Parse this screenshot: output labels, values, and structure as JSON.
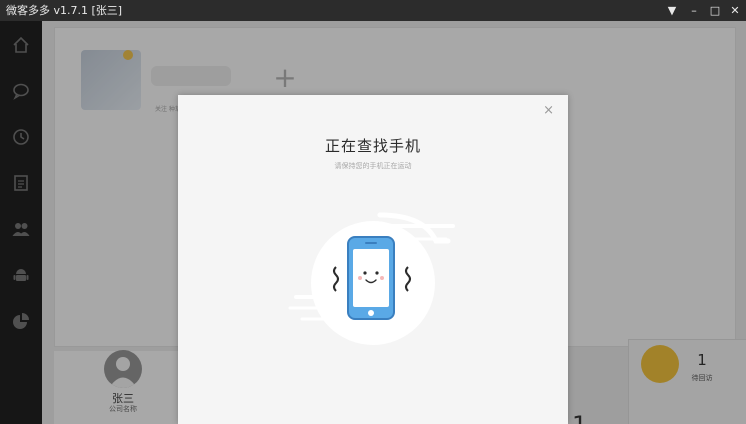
{
  "window": {
    "title": "微客多多 v1.7.1 [张三]",
    "controls": {
      "menu": "▼",
      "minimize": "–",
      "maximize": "□",
      "close": "✕"
    }
  },
  "sidebar": {
    "items": [
      {
        "icon": "home-icon"
      },
      {
        "icon": "chat-icon"
      },
      {
        "icon": "clock-icon"
      },
      {
        "icon": "document-icon"
      },
      {
        "icon": "contacts-icon"
      },
      {
        "icon": "android-icon"
      },
      {
        "icon": "pie-chart-icon"
      }
    ]
  },
  "account": {
    "sub_text": "关注  种草",
    "add_symbol": "+"
  },
  "user": {
    "name": "张三",
    "company": "公司名称"
  },
  "stats": {
    "pending_count": "1",
    "pending_label": "待回访",
    "bottom_count": "1"
  },
  "modal": {
    "title": "正在查找手机",
    "subtitle": "请保持您的手机正在运动",
    "close": "×"
  },
  "colors": {
    "titlebar": "#2c2c2c",
    "sidebar": "#1f1f1f",
    "phone_blue": "#5aa9e6",
    "phone_outline": "#3a7fbf",
    "pending_yellow": "#e1b53a"
  }
}
